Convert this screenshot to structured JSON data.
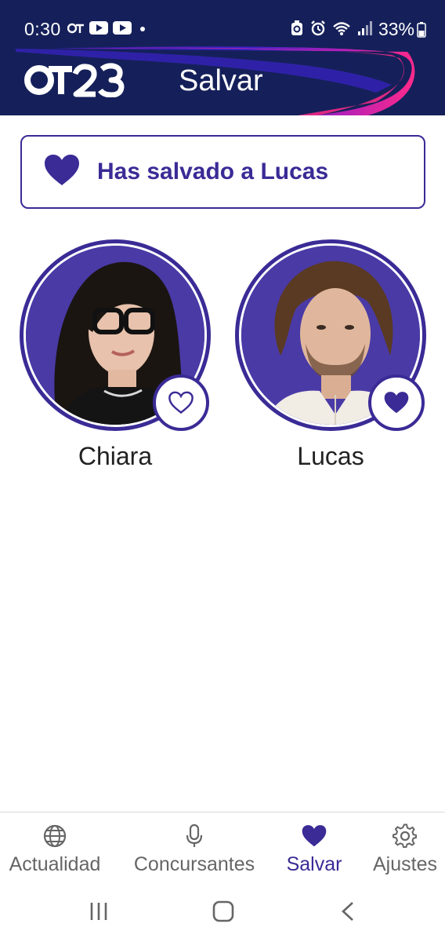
{
  "status_bar": {
    "time": "0:30",
    "battery": "33%",
    "icons": [
      "ot-icon",
      "youtube-icon",
      "youtube-icon",
      "dot-icon",
      "recycle-icon",
      "alarm-icon",
      "wifi-icon",
      "signal-icon",
      "battery-icon"
    ]
  },
  "app_bar": {
    "logo_text": "OT23",
    "title": "Salvar",
    "colors": {
      "background": "#15205a",
      "wave_pink": "#ff2a8a",
      "wave_purple": "#3b22b8"
    }
  },
  "banner": {
    "text": "Has salvado a Lucas",
    "icon": "heart-filled-icon"
  },
  "contestants": [
    {
      "name": "Chiara",
      "saved": false,
      "icon": "heart-outline-icon"
    },
    {
      "name": "Lucas",
      "saved": true,
      "icon": "heart-filled-icon"
    }
  ],
  "bottom_nav": [
    {
      "label": "Actualidad",
      "icon": "globe-icon",
      "active": false
    },
    {
      "label": "Concursantes",
      "icon": "microphone-icon",
      "active": false
    },
    {
      "label": "Salvar",
      "icon": "heart-icon",
      "active": true
    },
    {
      "label": "Ajustes",
      "icon": "gear-icon",
      "active": false
    }
  ],
  "system_nav": [
    "recents-icon",
    "home-icon",
    "back-icon"
  ],
  "accent_color": "#3a2b96"
}
